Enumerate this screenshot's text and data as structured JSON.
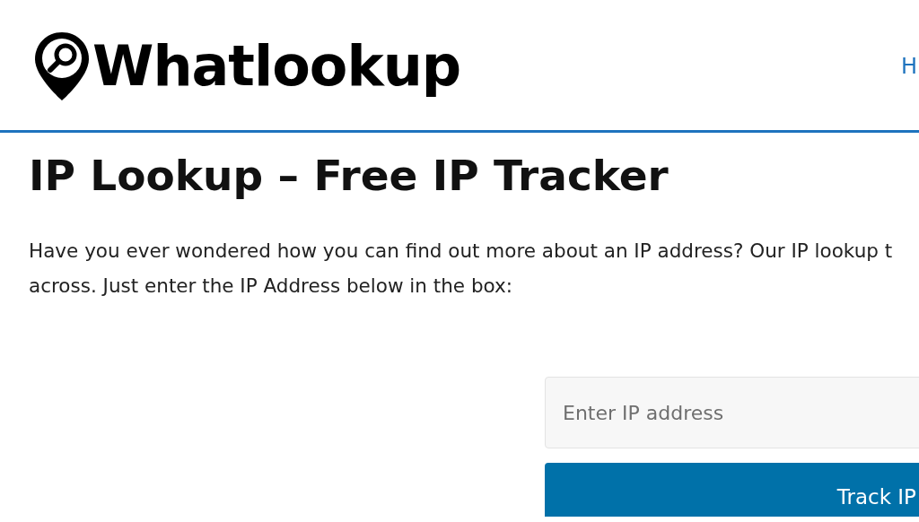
{
  "header": {
    "logo": "Whatlookup",
    "nav": [
      {
        "label": "H"
      }
    ]
  },
  "title": "IP Lookup – Free IP Tracker",
  "intro": [
    "Have you ever wondered how you can find out more about an IP address? Our IP lookup t",
    "across. Just enter the IP Address below in the box:"
  ],
  "form": {
    "ip_field": {
      "placeholder": "Enter IP address"
    },
    "button": "Track IP"
  }
}
